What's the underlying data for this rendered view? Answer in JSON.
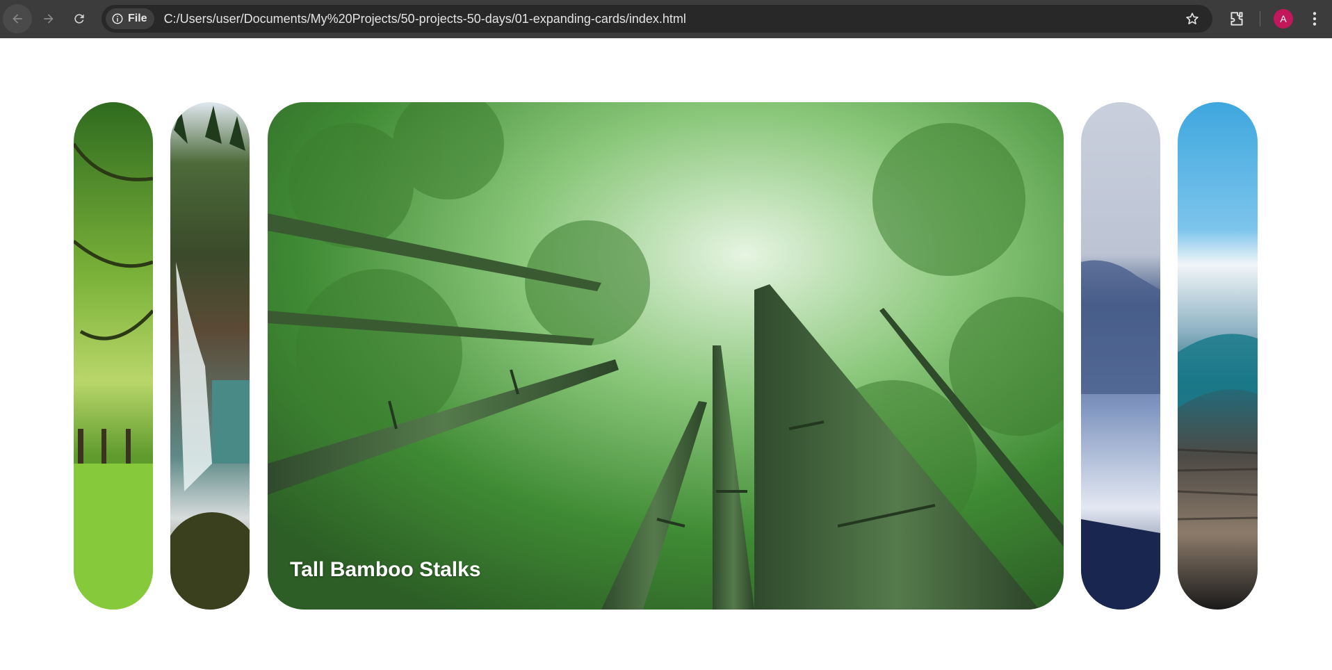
{
  "browser": {
    "site_chip_label": "File",
    "url": "C:/Users/user/Documents/My%20Projects/50-projects-50-days/01-expanding-cards/index.html",
    "avatar_initial": "A",
    "icons": [
      "back-arrow-icon",
      "forward-arrow-icon",
      "reload-icon",
      "info-icon",
      "star-icon",
      "extensions-icon",
      "more-vertical-icon"
    ]
  },
  "cards": {
    "active_index": 2,
    "items": [
      {
        "image": "green-trees-park",
        "title": ""
      },
      {
        "image": "waterfall-forest",
        "title": ""
      },
      {
        "image": "bamboo-forest",
        "title": "Tall Bamboo Stalks"
      },
      {
        "image": "snowy-mountain",
        "title": ""
      },
      {
        "image": "ocean-wave",
        "title": ""
      }
    ]
  },
  "colors": {
    "chrome_bg": "#3c3c3c",
    "omnibox_bg": "#282828",
    "avatar": "#c2185b",
    "page_bg": "#ffffff"
  }
}
